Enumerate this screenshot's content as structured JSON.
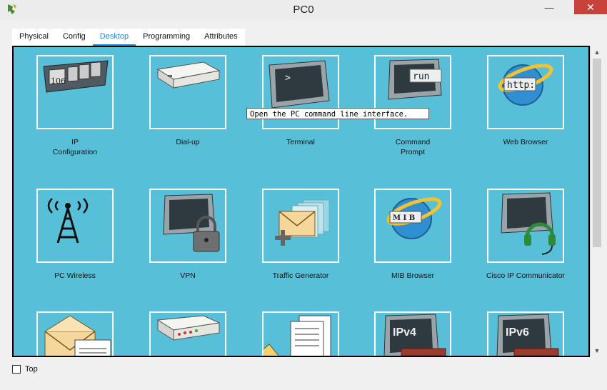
{
  "window": {
    "title": "PC0",
    "minimize_glyph": "—",
    "close_glyph": "✕"
  },
  "tabs": [
    {
      "label": "Physical",
      "active": false
    },
    {
      "label": "Config",
      "active": false
    },
    {
      "label": "Desktop",
      "active": true
    },
    {
      "label": "Programming",
      "active": false
    },
    {
      "label": "Attributes",
      "active": false
    }
  ],
  "apps": [
    {
      "name": "IP\nConfiguration",
      "icon": "ip-config-icon",
      "badge": "106"
    },
    {
      "name": "Dial-up",
      "icon": "modem-icon"
    },
    {
      "name": "Terminal",
      "icon": "terminal-icon",
      "badge": ">"
    },
    {
      "name": "Command\nPrompt",
      "icon": "command-prompt-icon",
      "badge": "run"
    },
    {
      "name": "Web Browser",
      "icon": "web-browser-icon",
      "badge": "http:"
    },
    {
      "name": "PC Wireless",
      "icon": "wireless-antenna-icon"
    },
    {
      "name": "VPN",
      "icon": "vpn-lock-icon"
    },
    {
      "name": "Traffic Generator",
      "icon": "traffic-generator-icon"
    },
    {
      "name": "MIB Browser",
      "icon": "mib-browser-icon",
      "badge": "M I B"
    },
    {
      "name": "Cisco IP Communicator",
      "icon": "ip-communicator-icon"
    },
    {
      "name": "",
      "icon": "email-icon"
    },
    {
      "name": "",
      "icon": "pppoe-dialer-icon"
    },
    {
      "name": "",
      "icon": "text-editor-icon"
    },
    {
      "name": "",
      "icon": "firewall-ipv4-icon",
      "badge": "IPv4"
    },
    {
      "name": "",
      "icon": "firewall-ipv6-icon",
      "badge": "IPv6"
    }
  ],
  "tooltip": "Open the PC command line interface.",
  "footer": {
    "top_checkbox_label": "Top",
    "top_checked": false
  },
  "colors": {
    "panel": "#58bfd8",
    "tab_active": "#2b87d1",
    "close_button": "#c7423a"
  }
}
